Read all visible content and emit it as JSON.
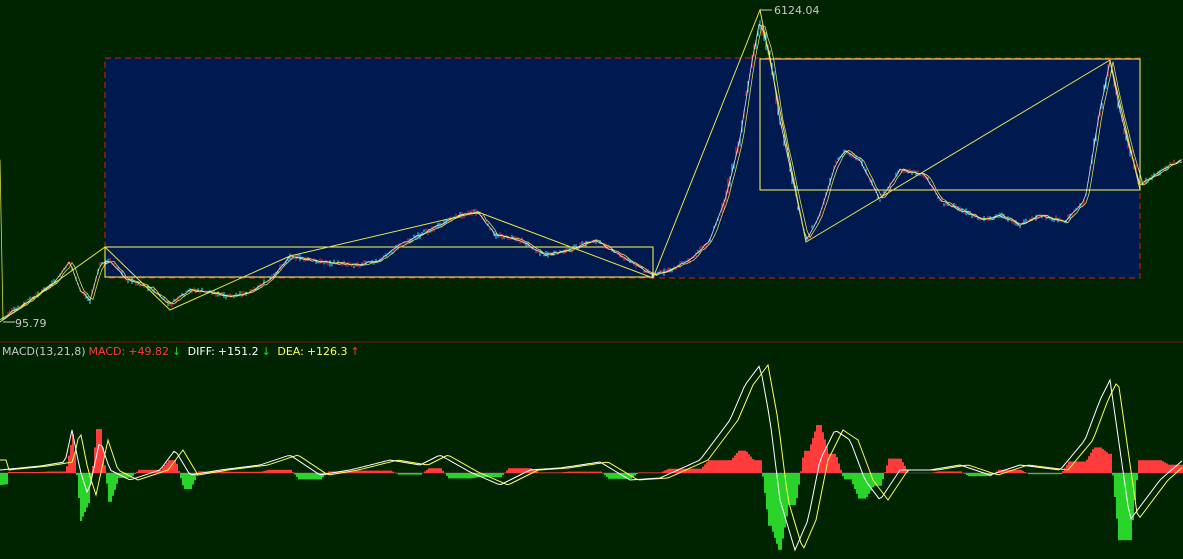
{
  "colors": {
    "background": "#002300",
    "box_fill": "#00194f",
    "box_dash": "#d22222",
    "yellow": "#ffff55",
    "zigzag": "#e6e64c",
    "up": "#ff3232",
    "down": "#40e0ff",
    "macd_pos": "#ff3b3b",
    "macd_neg": "#2ad32a",
    "diff": "#ffffff",
    "dea": "#ffff55",
    "divider": "#7a1010",
    "label": "#c8c8c8"
  },
  "price": {
    "high_label": "6124.04",
    "low_label": "95.79"
  },
  "macd": {
    "name": "MACD(13,21,8)",
    "macd_label": "MACD:",
    "macd_value": "+49.82",
    "macd_arrow": "↓",
    "diff_label": "DIFF:",
    "diff_value": "+151.2",
    "diff_arrow": "↓",
    "dea_label": "DEA:",
    "dea_value": "+126.3",
    "dea_arrow": "↑"
  },
  "chart_data": [
    {
      "type": "line",
      "series": [
        {
          "values": [
            95.79,
            1500,
            900,
            1300,
            6124.04,
            2000,
            3800,
            1900,
            4900,
            3000
          ]
        }
      ],
      "annotations": [
        "6124.04",
        "95.79"
      ]
    },
    {
      "type": "bar",
      "title": "MACD(13,21,8)",
      "series": [
        {
          "name": "MACD",
          "values": [
            49.82
          ]
        },
        {
          "name": "DIFF",
          "values": [
            151.2
          ]
        },
        {
          "name": "DEA",
          "values": [
            126.3
          ]
        }
      ]
    }
  ]
}
